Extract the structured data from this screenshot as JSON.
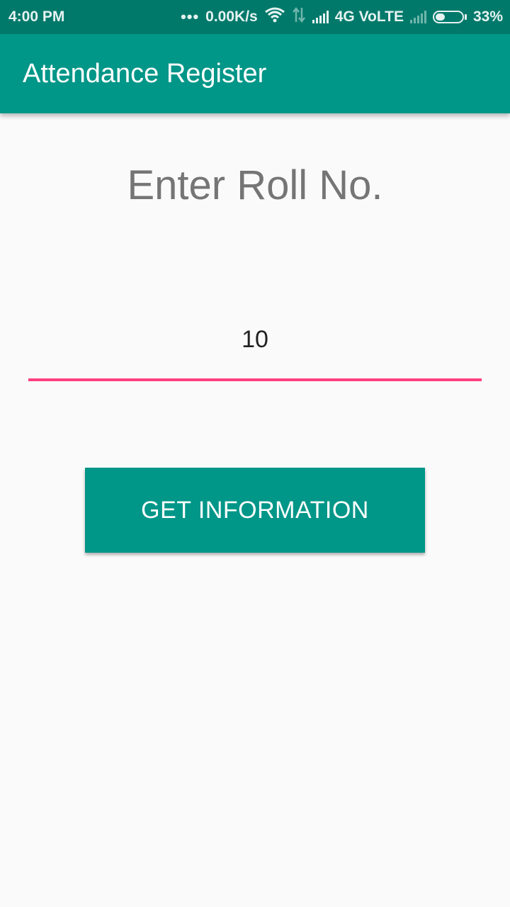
{
  "status_bar": {
    "time": "4:00 PM",
    "network_speed": "0.00K/s",
    "network_type": "4G VoLTE",
    "battery_percent": "33%",
    "battery_level": 0.33,
    "icons": [
      "more-dots-icon",
      "wifi-icon",
      "data-arrows-icon",
      "signal-icon",
      "signal-no-service-icon",
      "battery-icon"
    ]
  },
  "app_bar": {
    "title": "Attendance Register"
  },
  "main": {
    "prompt": "Enter Roll No.",
    "roll_input": {
      "value": "10"
    },
    "submit_label": "GET INFORMATION"
  },
  "colors": {
    "primary": "#009688",
    "primary_dark": "#00796b",
    "accent": "#ff4081",
    "background": "#fafafa",
    "prompt_text": "#757575"
  }
}
